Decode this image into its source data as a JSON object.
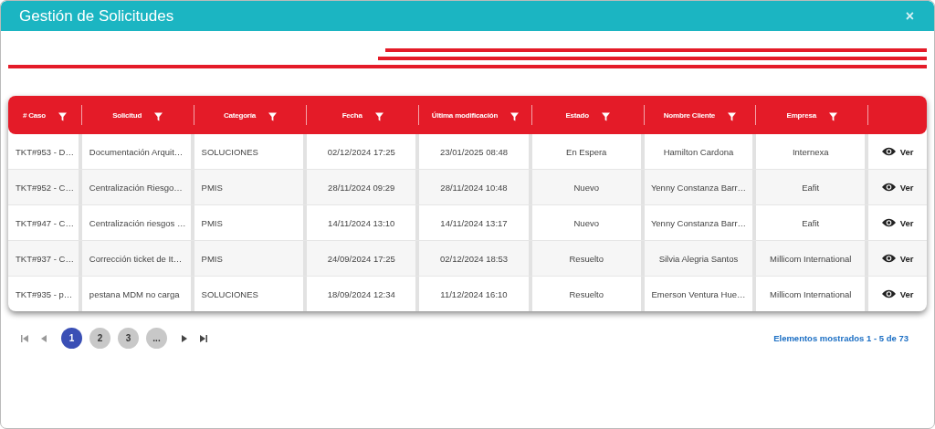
{
  "window": {
    "title": "Gestión de Solicitudes",
    "close": "×"
  },
  "table": {
    "columns": [
      {
        "label": "# Caso"
      },
      {
        "label": "Solicitud"
      },
      {
        "label": "Categoría"
      },
      {
        "label": "Fecha"
      },
      {
        "label": "Última modificación"
      },
      {
        "label": "Estado"
      },
      {
        "label": "Nombre Cliente"
      },
      {
        "label": "Empresa"
      }
    ],
    "rows": [
      {
        "cells": [
          "TKT#953 - D…",
          "Documentación Arquit…",
          "SOLUCIONES",
          "02/12/2024 17:25",
          "23/01/2025 08:48",
          "En Espera",
          "Hamilton Cardona",
          "Internexa"
        ],
        "action": "Ver"
      },
      {
        "cells": [
          "TKT#952 - C…",
          "Centralización Riesgo…",
          "PMIS",
          "28/11/2024 09:29",
          "28/11/2024 10:48",
          "Nuevo",
          "Yenny Constanza Barr…",
          "Eafit"
        ],
        "action": "Ver"
      },
      {
        "cells": [
          "TKT#947 - C…",
          "Centralización riesgos …",
          "PMIS",
          "14/11/2024 13:10",
          "14/11/2024 13:17",
          "Nuevo",
          "Yenny Constanza Barr…",
          "Eafit"
        ],
        "action": "Ver"
      },
      {
        "cells": [
          "TKT#937 - C…",
          "Corrección ticket de It…",
          "PMIS",
          "24/09/2024 17:25",
          "02/12/2024 18:53",
          "Resuelto",
          "Silvia Alegria Santos",
          "Millicom International"
        ],
        "action": "Ver"
      },
      {
        "cells": [
          "TKT#935 - p…",
          "pestana MDM no carga",
          "SOLUCIONES",
          "18/09/2024 12:34",
          "11/12/2024 16:10",
          "Resuelto",
          "Emerson Ventura Hue…",
          "Millicom International"
        ],
        "action": "Ver"
      }
    ]
  },
  "pagination": {
    "pages": [
      {
        "label": "1",
        "selected": true
      },
      {
        "label": "2",
        "selected": false
      },
      {
        "label": "3",
        "selected": false
      },
      {
        "label": "...",
        "selected": false
      }
    ],
    "summary": "Elementos mostrados 1 - 5 de 73"
  }
}
